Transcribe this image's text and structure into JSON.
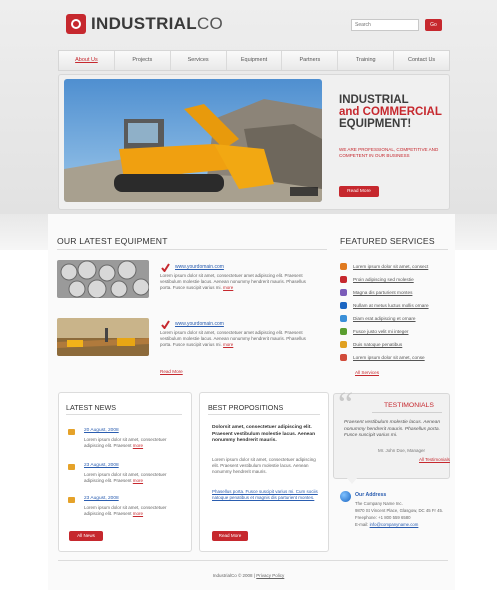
{
  "brand": {
    "name_main": "INDUSTRIAL",
    "name_suffix": "CO",
    "accent": "#c6282e",
    "link_color": "#2a5db0"
  },
  "search": {
    "placeholder": "Search",
    "button": "Go"
  },
  "nav": {
    "items": [
      "About Us",
      "Projects",
      "Services",
      "Equipment",
      "Partners",
      "Training",
      "Contact Us"
    ],
    "active_index": 0
  },
  "hero": {
    "title_line1": "INDUSTRIAL",
    "title_line2": "and COMMERCIAL",
    "title_line3": "EQUIPMENT!",
    "subtitle": "WE ARE PROFESSIONAL, COMPETITIVE AND COMPETENT IN OUR BUSINESS",
    "button": "Read More",
    "image_icon": "bulldozer-photo"
  },
  "equipment": {
    "title": "OUR LATEST EQUIPMENT",
    "items": [
      {
        "link": "www.yourdomain.com",
        "text": "Lorem ipsum dolor sit amet, consectetuer amet adipiscing elit. Praesent vestibulum molestie lacus. Aenean nonummy hendrerit mauris. Phasellus porta. Fusce suscipit varius mi.",
        "more": "more"
      },
      {
        "link": "www.yourdomain.com",
        "text": "Lorem ipsum dolor sit amet, consectetuer amet adipiscing elit. Praesent vestibulum molestie lacus. Aenean nonummy hendrerit mauris. Phasellus porta. Fusce suscipit varius mi.",
        "more": "more"
      }
    ],
    "view_all": "Read More"
  },
  "services": {
    "title": "FEATURED SERVICES",
    "items": [
      {
        "label": "Lorem ipsum dolor sit amet, consect",
        "color": "#e07a1f"
      },
      {
        "label": "Proin adipiscing sed molestie",
        "color": "#c6282e"
      },
      {
        "label": "Magna dis parturient montes",
        "color": "#7a5bb8"
      },
      {
        "label": "Nullam at metus luctus mollis ornare",
        "color": "#1b66c2"
      },
      {
        "label": "Diam erat adipiscing et ornare",
        "color": "#3a8fd8"
      },
      {
        "label": "Fusce justo velit mi integer",
        "color": "#5a9e2f"
      },
      {
        "label": "Duis natoque penatibus",
        "color": "#e0a020"
      },
      {
        "label": "Lorem ipsum dolor sit amet, conse",
        "color": "#d14b3a"
      }
    ],
    "view_all": "All Services"
  },
  "news": {
    "title": "LATEST NEWS",
    "items": [
      {
        "date": "20 August, 2008",
        "text": "Lorem ipsum dolor sit amet, consectetuer adipiscing elit. Praesent",
        "more": "more"
      },
      {
        "date": "23 August, 2008",
        "text": "Lorem ipsum dolor sit amet, consectetuer adipiscing elit. Praesent",
        "more": "more"
      },
      {
        "date": "23 August, 2008",
        "text": "Lorem ipsum dolor sit amet, consectetuer adipiscing elit. Praesent",
        "more": "more"
      }
    ],
    "button": "All News"
  },
  "propositions": {
    "title": "BEST PROPOSITIONS",
    "bold_text": "Dolorsit amet, consectetuer adipiscing elit. Praesent vestibulum molestie lacus. Aenean nonummy hendrerit mauris.",
    "text": "Lorem ipsum dolor sit amet, consectetuer adipiscing elit. Praesent vestibulum molestie lacus. Aenean nonummy hendrerit mauris.",
    "link_text": "Phasellus porta. Fusce suscipit varius mi. Cum sociis natoque penatibus et magnis dis parturient montes.",
    "button": "Read More"
  },
  "testimonials": {
    "title": "TESTIMONIALS",
    "quote": "Praesent vestibulum molestie lacus. Aenean nonummy hendrerit mauris. Phasellus porta. Fusce suscipit varius mi.",
    "author": "Mr. John Doe, Manager",
    "link": "All Testimonials"
  },
  "address": {
    "title": "Our Address",
    "lines": [
      "The Company Name Inc.",
      "9870 St Vincent Place, Glasgow, DC 45 Fr 45.",
      "Freephone:     +1 800 559 6580",
      "E-mail: "
    ],
    "email": "info@companyname.com"
  },
  "footer": {
    "copyright": "IndustrialCo © 2008",
    "separator": "|",
    "link": "Privacy Policy"
  }
}
